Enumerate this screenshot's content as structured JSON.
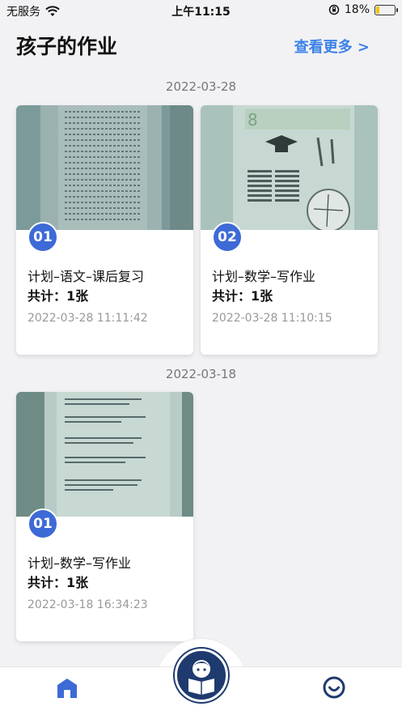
{
  "status_bar": {
    "carrier": "无服务",
    "time": "上午11:15",
    "battery_percent": "18%",
    "battery_level": 0.18
  },
  "header": {
    "title": "孩子的作业",
    "more_link": "查看更多 >"
  },
  "groups": [
    {
      "date": "2022-03-28",
      "cards": [
        {
          "badge": "01",
          "title": "计划–语文–课后复习",
          "count_label": "共计：",
          "count_value": "1张",
          "timestamp": "2022-03-28 11:11:42"
        },
        {
          "badge": "02",
          "title": "计划–数学–写作业",
          "count_label": "共计：",
          "count_value": "1张",
          "timestamp": "2022-03-28 11:10:15"
        }
      ]
    },
    {
      "date": "2022-03-18",
      "cards": [
        {
          "badge": "01",
          "title": "计划–数学–写作业",
          "count_label": "共计：",
          "count_value": "1张",
          "timestamp": "2022-03-18 16:34:23"
        }
      ]
    }
  ],
  "tab_bar": {
    "items": [
      {
        "icon": "home-icon",
        "active": true
      },
      {
        "icon": "reading-child-icon",
        "active": false
      },
      {
        "icon": "smile-profile-icon",
        "active": false
      }
    ]
  },
  "colors": {
    "accent": "#3b82e8",
    "badge": "#3d6ad6",
    "center_button": "#1f3a6e"
  }
}
